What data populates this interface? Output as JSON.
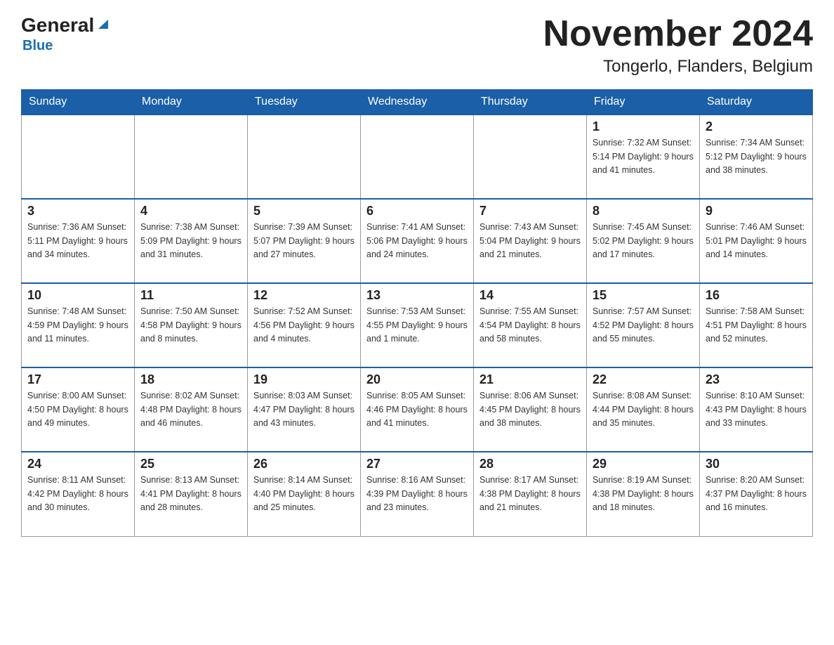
{
  "header": {
    "logo_general": "General",
    "logo_blue": "Blue",
    "month_title": "November 2024",
    "location": "Tongerlo, Flanders, Belgium"
  },
  "days_of_week": [
    "Sunday",
    "Monday",
    "Tuesday",
    "Wednesday",
    "Thursday",
    "Friday",
    "Saturday"
  ],
  "weeks": [
    [
      {
        "day": "",
        "info": ""
      },
      {
        "day": "",
        "info": ""
      },
      {
        "day": "",
        "info": ""
      },
      {
        "day": "",
        "info": ""
      },
      {
        "day": "",
        "info": ""
      },
      {
        "day": "1",
        "info": "Sunrise: 7:32 AM\nSunset: 5:14 PM\nDaylight: 9 hours\nand 41 minutes."
      },
      {
        "day": "2",
        "info": "Sunrise: 7:34 AM\nSunset: 5:12 PM\nDaylight: 9 hours\nand 38 minutes."
      }
    ],
    [
      {
        "day": "3",
        "info": "Sunrise: 7:36 AM\nSunset: 5:11 PM\nDaylight: 9 hours\nand 34 minutes."
      },
      {
        "day": "4",
        "info": "Sunrise: 7:38 AM\nSunset: 5:09 PM\nDaylight: 9 hours\nand 31 minutes."
      },
      {
        "day": "5",
        "info": "Sunrise: 7:39 AM\nSunset: 5:07 PM\nDaylight: 9 hours\nand 27 minutes."
      },
      {
        "day": "6",
        "info": "Sunrise: 7:41 AM\nSunset: 5:06 PM\nDaylight: 9 hours\nand 24 minutes."
      },
      {
        "day": "7",
        "info": "Sunrise: 7:43 AM\nSunset: 5:04 PM\nDaylight: 9 hours\nand 21 minutes."
      },
      {
        "day": "8",
        "info": "Sunrise: 7:45 AM\nSunset: 5:02 PM\nDaylight: 9 hours\nand 17 minutes."
      },
      {
        "day": "9",
        "info": "Sunrise: 7:46 AM\nSunset: 5:01 PM\nDaylight: 9 hours\nand 14 minutes."
      }
    ],
    [
      {
        "day": "10",
        "info": "Sunrise: 7:48 AM\nSunset: 4:59 PM\nDaylight: 9 hours\nand 11 minutes."
      },
      {
        "day": "11",
        "info": "Sunrise: 7:50 AM\nSunset: 4:58 PM\nDaylight: 9 hours\nand 8 minutes."
      },
      {
        "day": "12",
        "info": "Sunrise: 7:52 AM\nSunset: 4:56 PM\nDaylight: 9 hours\nand 4 minutes."
      },
      {
        "day": "13",
        "info": "Sunrise: 7:53 AM\nSunset: 4:55 PM\nDaylight: 9 hours\nand 1 minute."
      },
      {
        "day": "14",
        "info": "Sunrise: 7:55 AM\nSunset: 4:54 PM\nDaylight: 8 hours\nand 58 minutes."
      },
      {
        "day": "15",
        "info": "Sunrise: 7:57 AM\nSunset: 4:52 PM\nDaylight: 8 hours\nand 55 minutes."
      },
      {
        "day": "16",
        "info": "Sunrise: 7:58 AM\nSunset: 4:51 PM\nDaylight: 8 hours\nand 52 minutes."
      }
    ],
    [
      {
        "day": "17",
        "info": "Sunrise: 8:00 AM\nSunset: 4:50 PM\nDaylight: 8 hours\nand 49 minutes."
      },
      {
        "day": "18",
        "info": "Sunrise: 8:02 AM\nSunset: 4:48 PM\nDaylight: 8 hours\nand 46 minutes."
      },
      {
        "day": "19",
        "info": "Sunrise: 8:03 AM\nSunset: 4:47 PM\nDaylight: 8 hours\nand 43 minutes."
      },
      {
        "day": "20",
        "info": "Sunrise: 8:05 AM\nSunset: 4:46 PM\nDaylight: 8 hours\nand 41 minutes."
      },
      {
        "day": "21",
        "info": "Sunrise: 8:06 AM\nSunset: 4:45 PM\nDaylight: 8 hours\nand 38 minutes."
      },
      {
        "day": "22",
        "info": "Sunrise: 8:08 AM\nSunset: 4:44 PM\nDaylight: 8 hours\nand 35 minutes."
      },
      {
        "day": "23",
        "info": "Sunrise: 8:10 AM\nSunset: 4:43 PM\nDaylight: 8 hours\nand 33 minutes."
      }
    ],
    [
      {
        "day": "24",
        "info": "Sunrise: 8:11 AM\nSunset: 4:42 PM\nDaylight: 8 hours\nand 30 minutes."
      },
      {
        "day": "25",
        "info": "Sunrise: 8:13 AM\nSunset: 4:41 PM\nDaylight: 8 hours\nand 28 minutes."
      },
      {
        "day": "26",
        "info": "Sunrise: 8:14 AM\nSunset: 4:40 PM\nDaylight: 8 hours\nand 25 minutes."
      },
      {
        "day": "27",
        "info": "Sunrise: 8:16 AM\nSunset: 4:39 PM\nDaylight: 8 hours\nand 23 minutes."
      },
      {
        "day": "28",
        "info": "Sunrise: 8:17 AM\nSunset: 4:38 PM\nDaylight: 8 hours\nand 21 minutes."
      },
      {
        "day": "29",
        "info": "Sunrise: 8:19 AM\nSunset: 4:38 PM\nDaylight: 8 hours\nand 18 minutes."
      },
      {
        "day": "30",
        "info": "Sunrise: 8:20 AM\nSunset: 4:37 PM\nDaylight: 8 hours\nand 16 minutes."
      }
    ]
  ]
}
